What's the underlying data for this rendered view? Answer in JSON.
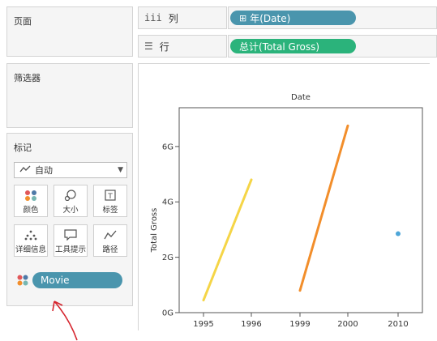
{
  "panels": {
    "pages_label": "页面",
    "filters_label": "筛选器",
    "marks_label": "标记"
  },
  "marks": {
    "type_label": "自动",
    "type_icon": "line-chart-icon",
    "buttons": [
      {
        "label": "颜色",
        "icon": "color-dots-icon"
      },
      {
        "label": "大小",
        "icon": "size-circles-icon"
      },
      {
        "label": "标签",
        "icon": "label-t-icon"
      },
      {
        "label": "详细信息",
        "icon": "detail-dots-icon"
      },
      {
        "label": "工具提示",
        "icon": "tooltip-icon"
      },
      {
        "label": "路径",
        "icon": "path-icon"
      }
    ],
    "color_field": "Movie"
  },
  "shelves": {
    "columns_label": "列",
    "columns_icon": "columns-icon",
    "columns_pill": "年(Date)",
    "rows_label": "行",
    "rows_icon": "rows-icon",
    "rows_pill": "总计(Total Gross)"
  },
  "chart_data": {
    "type": "line",
    "title": "Date",
    "ylabel": "Total Gross",
    "x_categories": [
      "1995",
      "1996",
      "1999",
      "2000",
      "2010"
    ],
    "y_ticks": [
      "0G",
      "2G",
      "4G",
      "6G"
    ],
    "ylim": [
      0,
      7.4
    ],
    "series": [
      {
        "color": "#f5d547",
        "points": [
          {
            "x": "1995",
            "y": 0.45
          },
          {
            "x": "1996",
            "y": 4.8
          }
        ]
      },
      {
        "color": "#f28e2b",
        "points": [
          {
            "x": "1999",
            "y": 0.8
          },
          {
            "x": "2000",
            "y": 6.75
          }
        ]
      },
      {
        "color": "#4ea6d8",
        "points": [
          {
            "x": "2010",
            "y": 2.85
          }
        ]
      }
    ]
  },
  "colors": {
    "pill_blue": "#4a95ad",
    "pill_green": "#2bb37b",
    "annotation_arrow": "#d6262f"
  }
}
